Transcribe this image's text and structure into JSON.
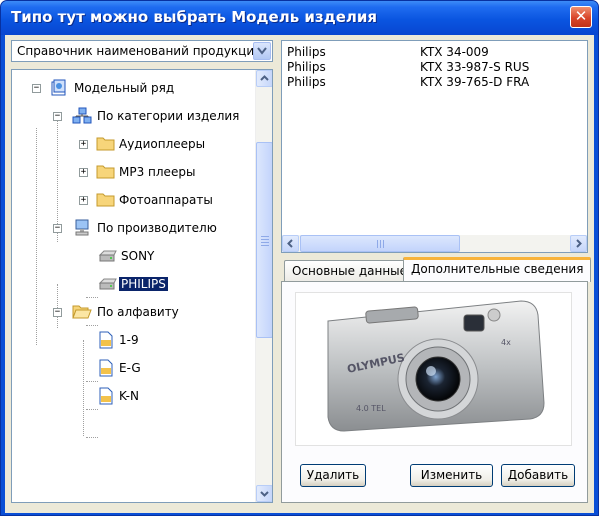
{
  "window": {
    "title": "Типо тут можно выбрать Модель изделия",
    "close_glyph": "✕"
  },
  "combo": {
    "value": "Справочник наименований продукции"
  },
  "tree": {
    "nodes": [
      {
        "label": "Модельный ряд",
        "icon": "catalog-icon"
      },
      {
        "label": "По категории изделия",
        "icon": "network-icon"
      },
      {
        "label": "Аудиоплееры",
        "icon": "folder-icon"
      },
      {
        "label": "MP3 плееры",
        "icon": "folder-icon"
      },
      {
        "label": "Фотоаппараты",
        "icon": "folder-icon"
      },
      {
        "label": "По производителю",
        "icon": "computer-icon"
      },
      {
        "label": "SONY",
        "icon": "drive-icon"
      },
      {
        "label": "PHILIPS",
        "icon": "drive-icon",
        "selected": true
      },
      {
        "label": "По алфавиту",
        "icon": "open-folder-icon"
      },
      {
        "label": "1-9",
        "icon": "document-icon"
      },
      {
        "label": "E-G",
        "icon": "document-icon"
      },
      {
        "label": "K-N",
        "icon": "document-icon"
      }
    ],
    "expander_plus": "+",
    "expander_minus": "−"
  },
  "list": {
    "rows": [
      {
        "brand": "Philips",
        "model": "KTX 34-009"
      },
      {
        "brand": "Philips",
        "model": "KTX 33-987-S RUS"
      },
      {
        "brand": "Philips",
        "model": "KTX 39-765-D FRA"
      }
    ]
  },
  "tabs": [
    {
      "label": "Основные данные",
      "active": false
    },
    {
      "label": "Дополнительные сведения",
      "active": true
    }
  ],
  "photo": {
    "brand_text": "OLYMPUS",
    "icon": "camera-image"
  },
  "buttons": {
    "delete": "Удалить",
    "edit": "Изменить",
    "add": "Добавить"
  },
  "colors": {
    "titlebar": "#0a55e0",
    "selection": "#0a246a",
    "active_tab_accent": "#f8b33a"
  }
}
